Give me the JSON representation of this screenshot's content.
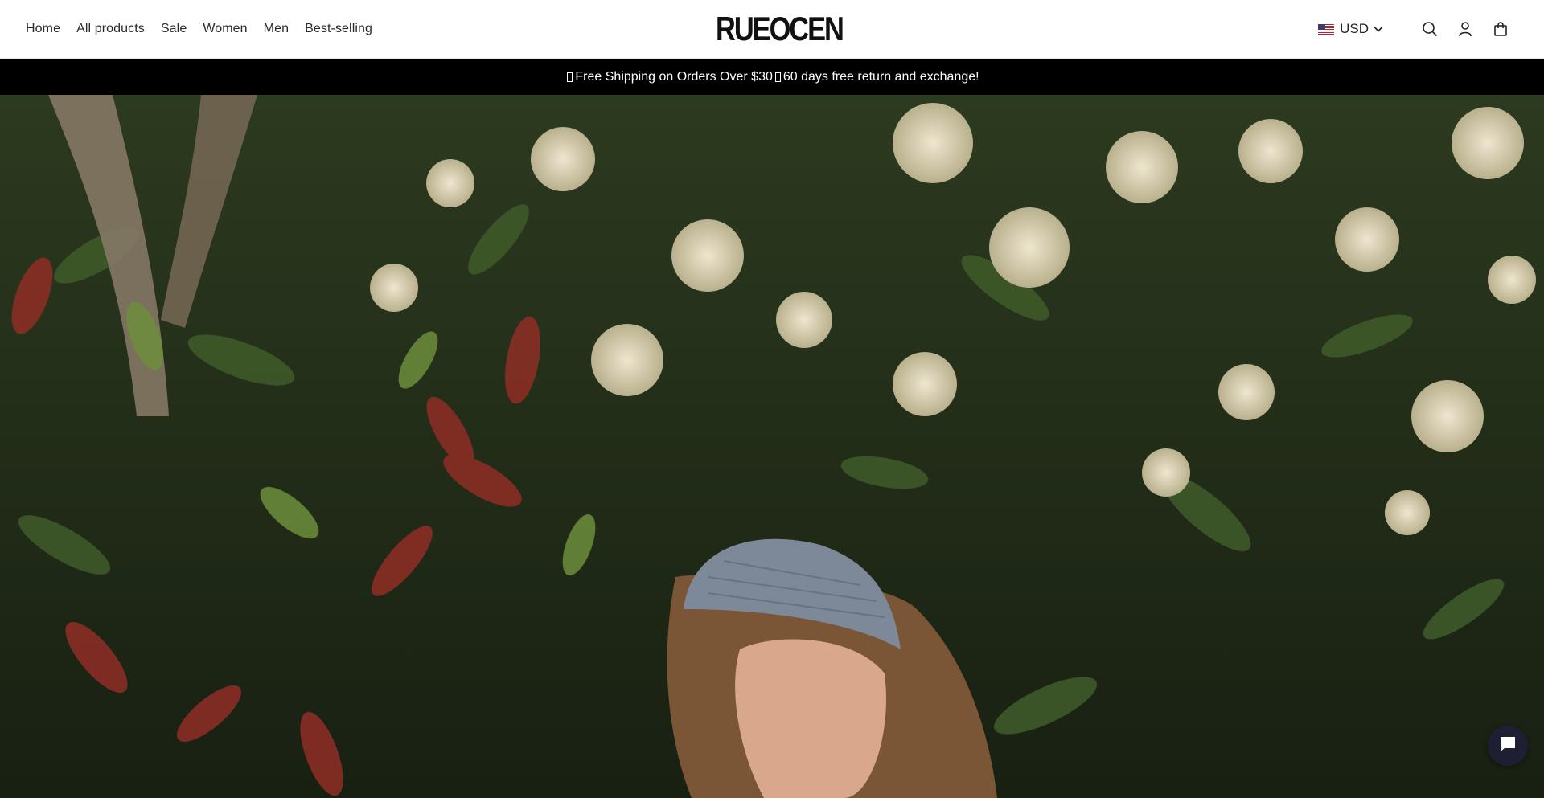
{
  "header": {
    "nav": [
      {
        "label": "Home"
      },
      {
        "label": "All products"
      },
      {
        "label": "Sale"
      },
      {
        "label": "Women"
      },
      {
        "label": "Men"
      },
      {
        "label": "Best-selling"
      }
    ],
    "logo_text": "RUEOCEN",
    "currency": {
      "label": "USD",
      "flag": "us-flag"
    },
    "icons": [
      "search-icon",
      "account-icon",
      "cart-icon"
    ]
  },
  "announcement": {
    "part1": "Free Shipping on Orders Over $30",
    "part2": "60 days free return and exchange!"
  },
  "hero": {
    "image": "woman-in-bandana-among-flowering-shrubs"
  },
  "chat": {
    "icon": "chat-icon"
  },
  "colors": {
    "announcement_bg": "#000000",
    "chat_button": "#1f1f33",
    "foliage": "#2f3d22"
  }
}
